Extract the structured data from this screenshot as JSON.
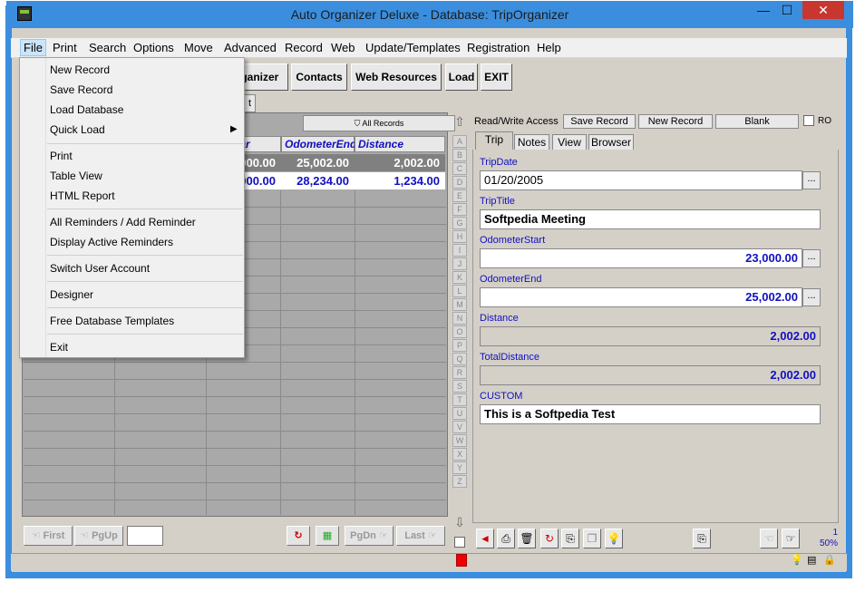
{
  "window": {
    "title": "Auto Organizer Deluxe - Database: TripOrganizer",
    "minimize": "—",
    "maximize": "☐",
    "close": "✕"
  },
  "menubar": {
    "items": [
      "File",
      "Print",
      "Search",
      "Options",
      "Move",
      "Advanced",
      "Record",
      "Web",
      "Update/Templates",
      "Registration",
      "Help"
    ]
  },
  "toolbar": {
    "organizer": "rganizer",
    "contacts": "Contacts",
    "web_resources": "Web Resources",
    "load": "Load",
    "exit": "EXIT"
  },
  "left_tab": "t",
  "grid": {
    "all_records": "All Records",
    "headers": [
      "terStar",
      "OdometerEnd",
      "Distance"
    ],
    "rows": [
      [
        "000.00",
        "25,002.00",
        "2,002.00"
      ],
      [
        "000.00",
        "28,234.00",
        "1,234.00"
      ]
    ]
  },
  "nav": {
    "first": "First",
    "pgup": "PgUp",
    "pgdn": "PgDn",
    "last": "Last"
  },
  "alphabet": [
    "A",
    "B",
    "C",
    "D",
    "E",
    "F",
    "G",
    "H",
    "I",
    "J",
    "K",
    "L",
    "M",
    "N",
    "O",
    "P",
    "Q",
    "R",
    "S",
    "T",
    "U",
    "V",
    "W",
    "X",
    "Y",
    "Z"
  ],
  "right_header": {
    "access": "Read/Write Access",
    "save_record": "Save Record",
    "new_record": "New Record",
    "blank": "Blank",
    "ro": "RO"
  },
  "tabs": [
    "Trip",
    "Notes",
    "View",
    "Browser"
  ],
  "form": {
    "trip_date_label": "TripDate",
    "trip_date": "01/20/2005",
    "trip_title_label": "TripTitle",
    "trip_title": "Softpedia Meeting",
    "odometer_start_label": "OdometerStart",
    "odometer_start": "23,000.00",
    "odometer_end_label": "OdometerEnd",
    "odometer_end": "25,002.00",
    "distance_label": "Distance",
    "distance": "2,002.00",
    "total_distance_label": "TotalDistance",
    "total_distance": "2,002.00",
    "custom_label": "CUSTOM",
    "custom": "This is a Softpedia Test",
    "dots": "..."
  },
  "counter": {
    "record": "1",
    "zoom": "50%"
  },
  "file_menu": {
    "items": [
      "New Record",
      "Save Record",
      "Load Database",
      "Quick Load",
      "Print",
      "Table View",
      "HTML Report",
      "All Reminders / Add Reminder",
      "Display Active Reminders",
      "Switch User Account",
      "Designer",
      "Free Database Templates",
      "Exit"
    ]
  },
  "colors": {
    "titlebar": "#3b8ede",
    "close": "#c7372f",
    "field_blue": "#1010c0",
    "panel": "#d4d0c8"
  }
}
